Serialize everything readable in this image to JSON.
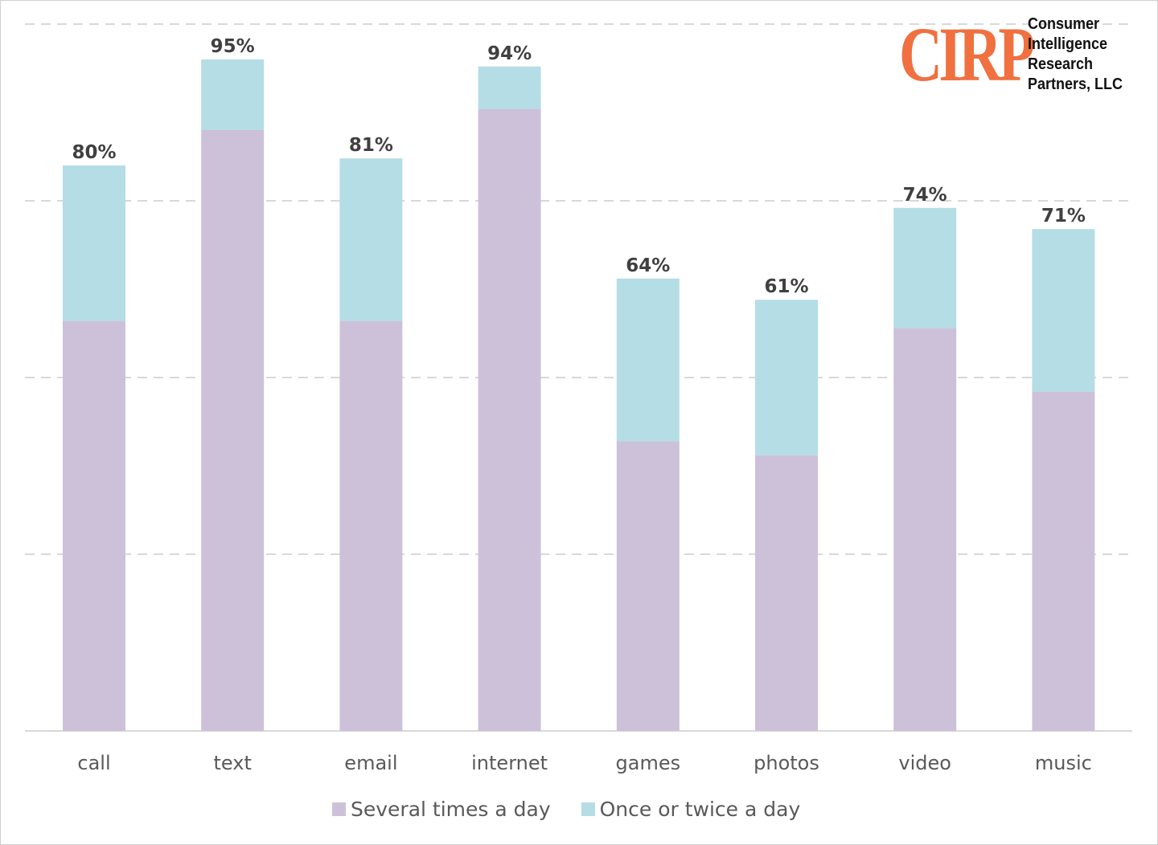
{
  "chart_data": {
    "type": "bar",
    "stacked": true,
    "title": "",
    "xlabel": "",
    "ylabel": "",
    "ylim": [
      0,
      100
    ],
    "grid": true,
    "legend_position": "bottom",
    "categories": [
      "call",
      "text",
      "email",
      "internet",
      "games",
      "photos",
      "video",
      "music"
    ],
    "series": [
      {
        "name": "Several times a day",
        "color": "#cdc1da",
        "values": [
          58,
          85,
          58,
          88,
          41,
          39,
          57,
          48
        ]
      },
      {
        "name": "Once or twice a day",
        "color": "#b5dde5",
        "values": [
          22,
          10,
          23,
          6,
          23,
          22,
          17,
          23
        ]
      }
    ],
    "totals": [
      80,
      95,
      81,
      94,
      64,
      61,
      74,
      71
    ],
    "total_labels": [
      "80%",
      "95%",
      "81%",
      "94%",
      "64%",
      "61%",
      "74%",
      "71%"
    ]
  },
  "logo": {
    "mark": "CIRP",
    "lines": [
      "Consumer",
      "Intelligence",
      "Research",
      "Partners, LLC"
    ]
  }
}
